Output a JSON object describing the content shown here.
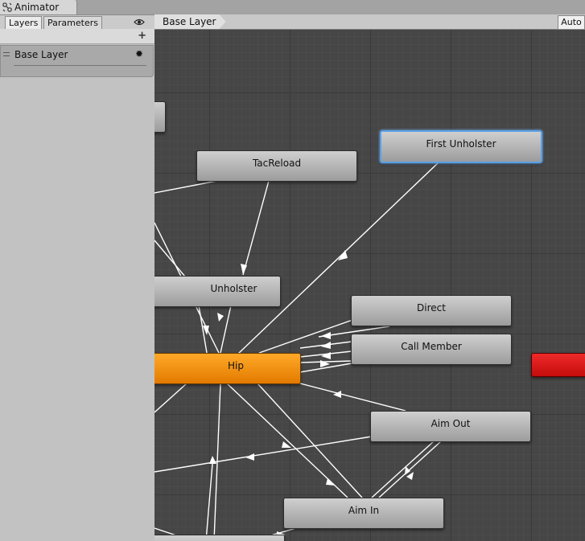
{
  "window": {
    "tab_title": "Animator",
    "icon": "animator-icon"
  },
  "left_panel": {
    "tabs": [
      {
        "label": "Layers",
        "active": true
      },
      {
        "label": "Parameters",
        "active": false
      }
    ],
    "eye_icon": "eye-icon",
    "add_icon": "plus-icon",
    "layers": [
      {
        "name": "Base Layer",
        "gear_icon": "gear-icon"
      }
    ]
  },
  "graph": {
    "breadcrumb": "Base Layer",
    "auto_button": "Auto",
    "states": {
      "first_unholster": "First Unholster",
      "tacreload": "TacReload",
      "unholster": "Unholster",
      "direct": "Direct",
      "call_member": "Call Member",
      "hip": "Hip",
      "aim_out": "Aim Out",
      "aim_in": "Aim In"
    },
    "colors": {
      "default_state": "#f28c10",
      "exit_state": "#dd1515",
      "selected_outline": "#5aa0e6",
      "transition": "#ffffff"
    }
  }
}
